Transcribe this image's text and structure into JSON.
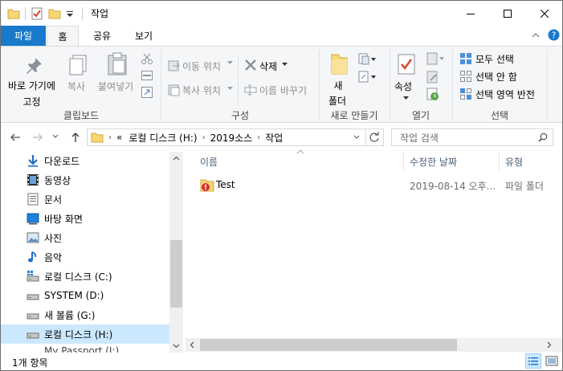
{
  "window": {
    "title": "작업",
    "minimize_glyph": "—",
    "maximize_glyph": "☐",
    "close_glyph": "✕"
  },
  "tabs": {
    "file": "파일",
    "home": "홈",
    "share": "공유",
    "view": "보기"
  },
  "ribbon": {
    "clipboard": {
      "label": "클립보드",
      "pin": "바로 가기에\n고정",
      "pin_line1": "바로 가기에",
      "pin_line2": "고정",
      "copy": "복사",
      "paste": "붙여넣기"
    },
    "organize": {
      "label": "구성",
      "move_to": "이동 위치",
      "copy_to": "복사 위치",
      "delete": "삭제",
      "rename": "이름 바꾸기"
    },
    "new": {
      "label": "새로 만들기",
      "new_folder_line1": "새",
      "new_folder_line2": "폴더"
    },
    "open": {
      "label": "열기",
      "properties": "속성"
    },
    "select": {
      "label": "선택",
      "select_all": "모두 선택",
      "select_none": "선택 안 함",
      "invert": "선택 영역 반전"
    }
  },
  "address": {
    "overflow": "«",
    "crumbs": [
      "로컬 디스크 (H:)",
      "2019소스",
      "작업"
    ]
  },
  "search": {
    "placeholder": "작업 검색"
  },
  "nav": {
    "items": [
      {
        "label": "다운로드",
        "icon": "download-icon"
      },
      {
        "label": "동영상",
        "icon": "video-icon"
      },
      {
        "label": "문서",
        "icon": "document-icon"
      },
      {
        "label": "바탕 화면",
        "icon": "desktop-icon"
      },
      {
        "label": "사진",
        "icon": "picture-icon"
      },
      {
        "label": "음악",
        "icon": "music-icon"
      },
      {
        "label": "로컬 디스크 (C:)",
        "icon": "windows-drive-icon"
      },
      {
        "label": "SYSTEM (D:)",
        "icon": "drive-icon"
      },
      {
        "label": "새 볼륨 (G:)",
        "icon": "drive-icon"
      },
      {
        "label": "로컬 디스크 (H:)",
        "icon": "drive-icon",
        "selected": true
      },
      {
        "label": "My Passport (I:)",
        "icon": "drive-icon"
      }
    ]
  },
  "columns": {
    "name": "이름",
    "date": "수정한 날짜",
    "type": "유형"
  },
  "files": [
    {
      "name": "Test",
      "date": "2019-08-14 오후...",
      "type": "파일 폴더"
    }
  ],
  "status": {
    "count": "1개 항목"
  },
  "colors": {
    "file_tab": "#1979ca",
    "ribbon_bg": "#f5f6f7",
    "selected_nav": "#cce8ff",
    "folder": "#f8d775"
  }
}
